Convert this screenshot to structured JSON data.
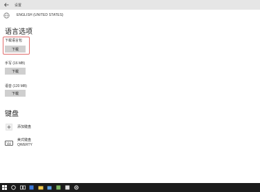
{
  "window": {
    "title": "设置"
  },
  "language_header": {
    "language": "ENGLISH (UNITED STATES)"
  },
  "language_options": {
    "heading": "语言选项",
    "items": [
      {
        "label": "下载语言包",
        "button": "下载"
      },
      {
        "label": "手写 (16 MB)",
        "button": "下载"
      },
      {
        "label": "语音 (120 MB)",
        "button": "下载"
      }
    ]
  },
  "keyboard": {
    "heading": "键盘",
    "add_label": "添加键盘",
    "entry": {
      "line1": "美式键盘",
      "line2": "QWERTY"
    }
  },
  "colors": {
    "highlight": "#e06b6b",
    "taskbar": "#1b1b1b",
    "titlebar": "#e6e6e6"
  },
  "taskbar": {
    "icons": [
      "windows-start-icon",
      "search-icon",
      "task-view-icon",
      "edge-icon",
      "file-explorer-icon",
      "store-icon",
      "app-icon",
      "app-icon-2",
      "settings-icon"
    ]
  }
}
